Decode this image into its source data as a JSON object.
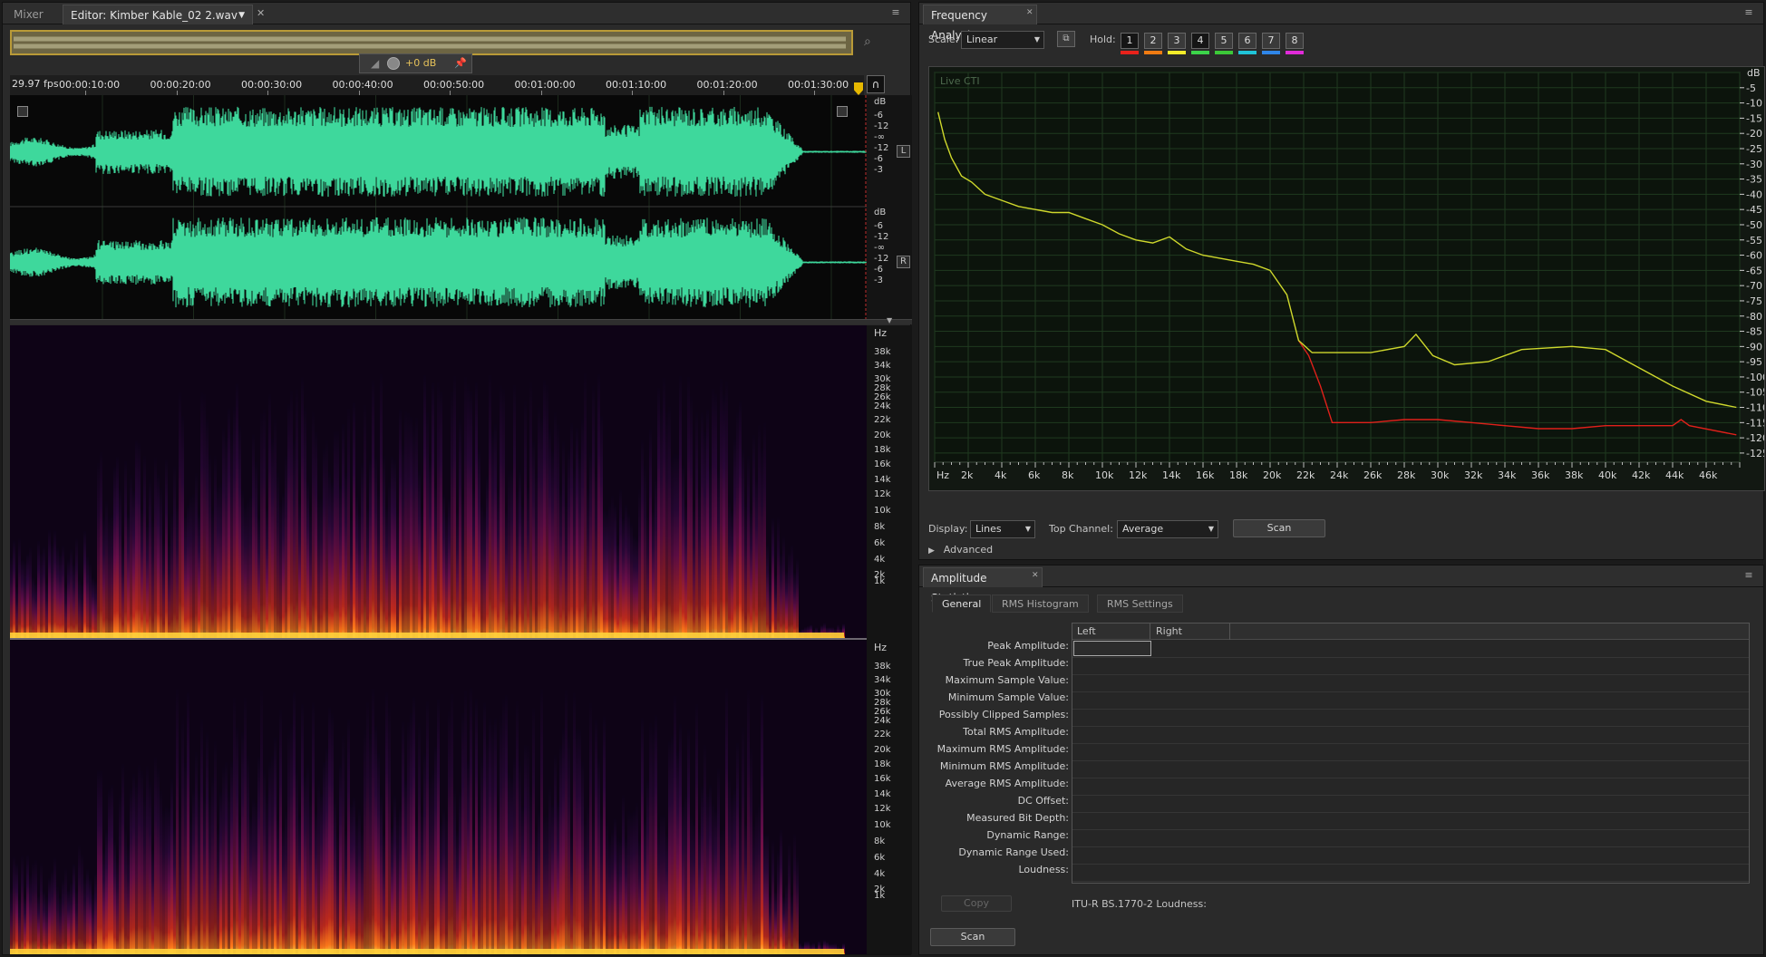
{
  "editor": {
    "tabs": [
      "Mixer",
      "Editor: Kimber Kable_02 2.wav *"
    ],
    "fps": "29.97 fps",
    "timecodes": [
      "00:00:10:00",
      "00:00:20:00",
      "00:00:30:00",
      "00:00:40:00",
      "00:00:50:00",
      "00:01:00:00",
      "00:01:10:00",
      "00:01:20:00",
      "00:01:30:00"
    ],
    "volume": "+0 dB",
    "db_scale_label": "dB",
    "db_ticks": [
      "-6",
      "-12",
      "-∞",
      "-12",
      "-6",
      "-3"
    ],
    "channels": [
      "L",
      "R"
    ],
    "hz_label": "Hz",
    "hz_ticks": [
      "38k",
      "34k",
      "30k",
      "28k",
      "26k",
      "24k",
      "22k",
      "20k",
      "18k",
      "16k",
      "14k",
      "12k",
      "10k",
      "8k",
      "6k",
      "4k",
      "2k",
      "1k"
    ]
  },
  "frequency_analysis": {
    "title": "Frequency Analysis",
    "scale_label": "Scale:",
    "scale_value": "Linear",
    "hold_label": "Hold:",
    "hold_buttons": [
      {
        "label": "1",
        "color": "#e8221b"
      },
      {
        "label": "2",
        "color": "#f07b12"
      },
      {
        "label": "3",
        "color": "#f4ec2a"
      },
      {
        "label": "4",
        "color": "#3cd44a"
      },
      {
        "label": "5",
        "color": "#3cc838"
      },
      {
        "label": "6",
        "color": "#20c4d8"
      },
      {
        "label": "7",
        "color": "#2f86e8"
      },
      {
        "label": "8",
        "color": "#e02bd8"
      }
    ],
    "graph_title": "Live CTI",
    "display_label": "Display:",
    "display_value": "Lines",
    "top_channel_label": "Top Channel:",
    "top_channel_value": "Average",
    "scan_label": "Scan",
    "advanced_label": "Advanced",
    "y_axis_unit": "dB",
    "x_axis_unit": "Hz",
    "chart_data": {
      "type": "line",
      "xlabel": "Hz",
      "ylabel": "dB",
      "x_ticks": [
        "2k",
        "4k",
        "6k",
        "8k",
        "10k",
        "12k",
        "14k",
        "16k",
        "18k",
        "20k",
        "22k",
        "24k",
        "26k",
        "28k",
        "30k",
        "32k",
        "34k",
        "36k",
        "38k",
        "40k",
        "42k",
        "44k",
        "46k"
      ],
      "y_ticks": [
        "-5",
        "-10",
        "-15",
        "-20",
        "-25",
        "-30",
        "-35",
        "-40",
        "-45",
        "-50",
        "-55",
        "-60",
        "-65",
        "-70",
        "-75",
        "-80",
        "-85",
        "-90",
        "-95",
        "-100",
        "-105",
        "-110",
        "-115",
        "-120",
        "-125"
      ],
      "xlim": [
        0,
        48000
      ],
      "ylim": [
        -128,
        0
      ],
      "grid": true,
      "series": [
        {
          "color": "#cfd82c",
          "values_xy": [
            [
              200,
              -13
            ],
            [
              600,
              -22
            ],
            [
              1000,
              -28
            ],
            [
              1600,
              -34
            ],
            [
              2200,
              -36
            ],
            [
              3000,
              -40
            ],
            [
              4000,
              -42
            ],
            [
              5000,
              -44
            ],
            [
              6000,
              -45
            ],
            [
              7000,
              -46
            ],
            [
              8000,
              -46
            ],
            [
              9000,
              -48
            ],
            [
              10000,
              -50
            ],
            [
              11000,
              -53
            ],
            [
              12000,
              -55
            ],
            [
              13000,
              -56
            ],
            [
              14000,
              -54
            ],
            [
              15000,
              -58
            ],
            [
              16000,
              -60
            ],
            [
              17000,
              -61
            ],
            [
              18000,
              -62
            ],
            [
              19000,
              -63
            ],
            [
              20000,
              -65
            ],
            [
              21000,
              -73
            ],
            [
              21700,
              -88
            ],
            [
              22500,
              -92
            ],
            [
              24000,
              -92
            ],
            [
              26000,
              -92
            ],
            [
              28000,
              -90
            ],
            [
              28700,
              -86
            ],
            [
              29700,
              -93
            ],
            [
              31000,
              -96
            ],
            [
              33000,
              -95
            ],
            [
              35000,
              -91
            ],
            [
              38000,
              -90
            ],
            [
              40000,
              -91
            ],
            [
              42000,
              -97
            ],
            [
              44000,
              -103
            ],
            [
              46000,
              -108
            ],
            [
              47800,
              -110
            ]
          ]
        },
        {
          "color": "#e0201a",
          "values_xy": [
            [
              21700,
              -88
            ],
            [
              22300,
              -93
            ],
            [
              23000,
              -103
            ],
            [
              23700,
              -115
            ],
            [
              24500,
              -115
            ],
            [
              26000,
              -115
            ],
            [
              28000,
              -114
            ],
            [
              30000,
              -114
            ],
            [
              32000,
              -115
            ],
            [
              34000,
              -116
            ],
            [
              36000,
              -117
            ],
            [
              38000,
              -117
            ],
            [
              40000,
              -116
            ],
            [
              42000,
              -116
            ],
            [
              44000,
              -116
            ],
            [
              44500,
              -114
            ],
            [
              45000,
              -116
            ],
            [
              47800,
              -119
            ]
          ]
        }
      ]
    }
  },
  "amplitude_statistics": {
    "title": "Amplitude Statistics",
    "tabs": [
      "General",
      "RMS Histogram",
      "RMS Settings"
    ],
    "columns": [
      "Left",
      "Right"
    ],
    "rows": [
      "Peak Amplitude:",
      "True Peak Amplitude:",
      "Maximum Sample Value:",
      "Minimum Sample Value:",
      "Possibly Clipped Samples:",
      "Total RMS Amplitude:",
      "Maximum RMS Amplitude:",
      "Minimum RMS Amplitude:",
      "Average RMS Amplitude:",
      "DC Offset:",
      "Measured Bit Depth:",
      "Dynamic Range:",
      "Dynamic Range Used:",
      "Loudness:"
    ],
    "copy_label": "Copy",
    "itu_label": "ITU-R BS.1770-2 Loudness:",
    "scan_label": "Scan"
  }
}
